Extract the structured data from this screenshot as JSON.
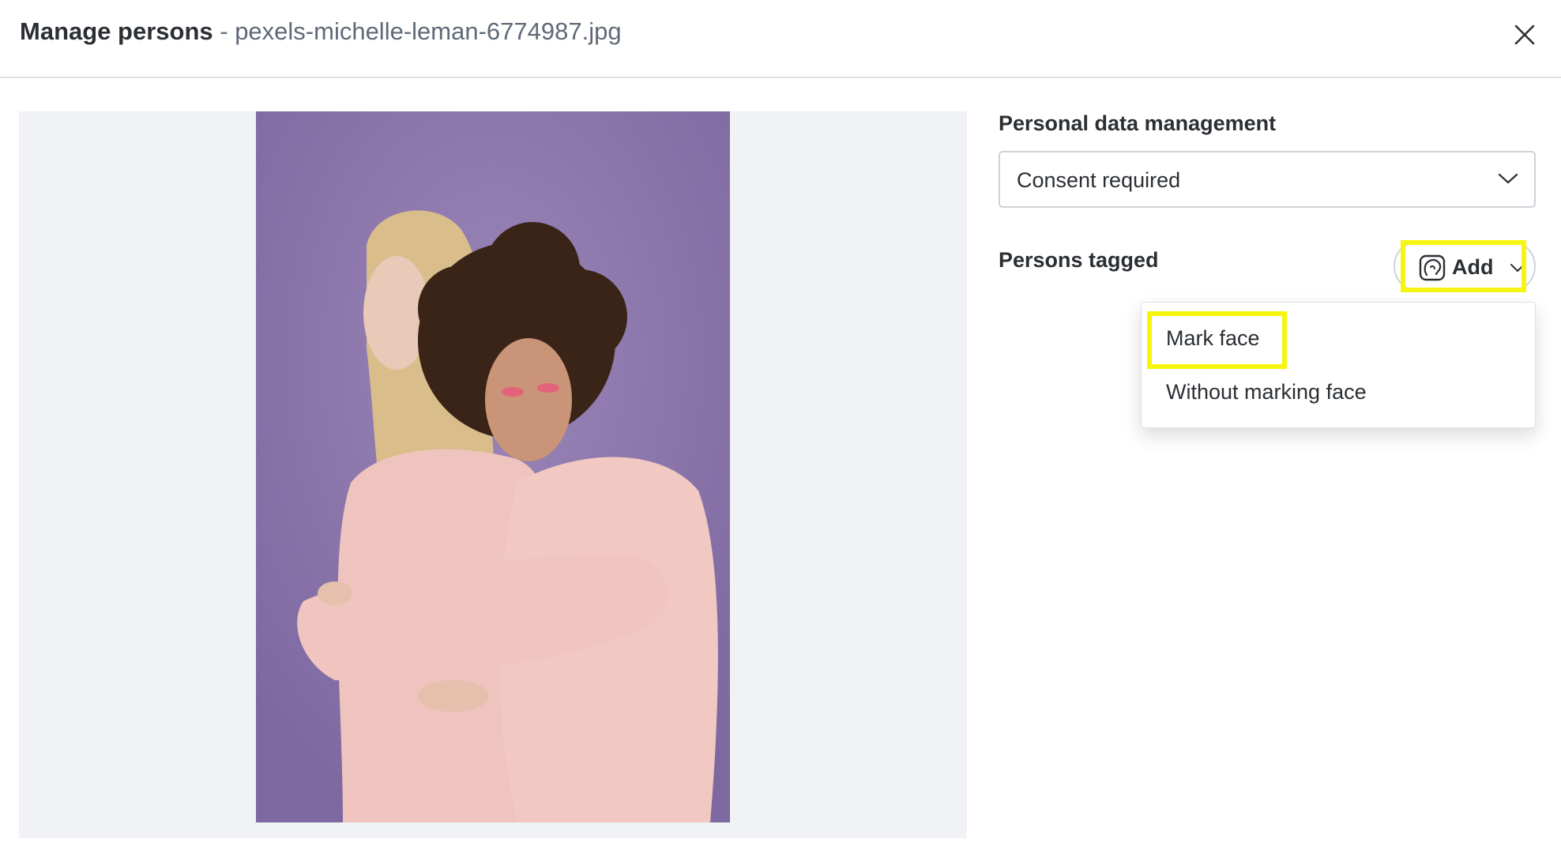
{
  "dialog": {
    "title": "Manage persons",
    "separator": " - ",
    "filename": "pexels-michelle-leman-6774987.jpg"
  },
  "icons": {
    "close": "close-icon",
    "select_chevron": "chevron-down-icon",
    "face": "face-icon",
    "add_chevron": "chevron-down-icon"
  },
  "personal_data": {
    "label": "Personal data management",
    "selected": "Consent required"
  },
  "persons": {
    "label": "Persons tagged",
    "add_label": "Add"
  },
  "add_menu": {
    "items": [
      "Mark face",
      "Without marking face"
    ]
  },
  "colors": {
    "highlight": "#f6f50f",
    "photo_background": "#8a73a8",
    "preview_background": "#f1f2f6"
  }
}
